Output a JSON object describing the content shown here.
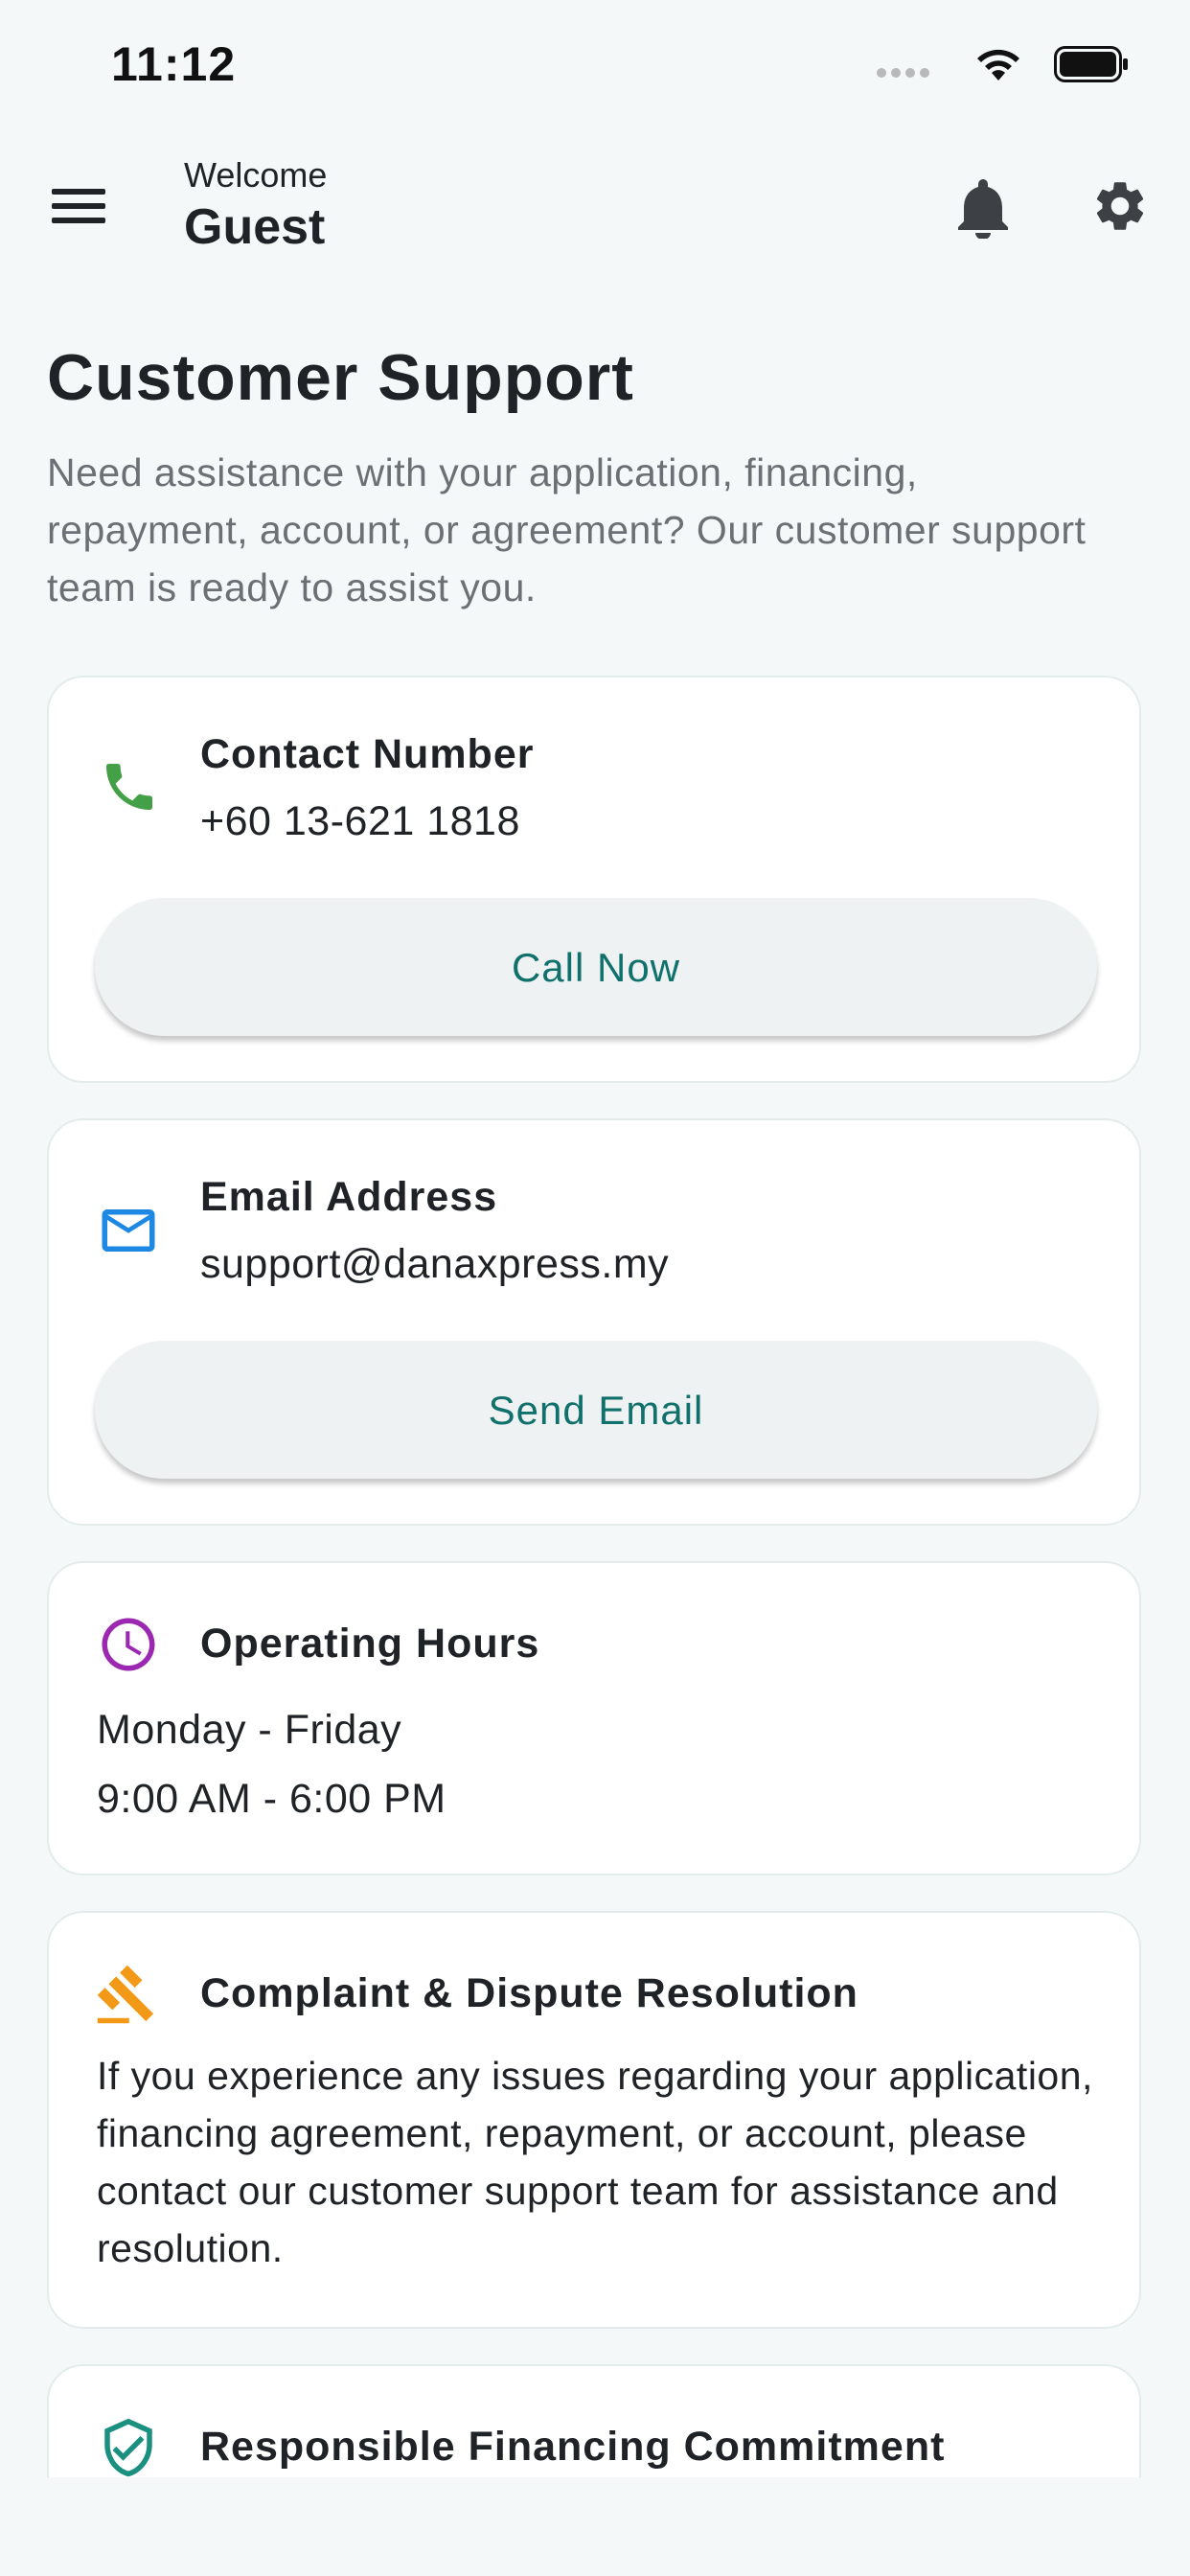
{
  "status_bar": {
    "time": "11:12",
    "icons": [
      "signal-dots-icon",
      "wifi-icon",
      "battery-icon"
    ]
  },
  "header": {
    "welcome": "Welcome",
    "user_name": "Guest",
    "icons": [
      "menu-icon",
      "bell-icon",
      "gear-icon"
    ]
  },
  "page": {
    "title": "Customer Support",
    "description": "Need assistance with your application, financing, repayment, account, or agreement? Our customer support team is ready to assist you."
  },
  "contact": {
    "icon": "phone-icon",
    "title": "Contact Number",
    "value": "+60 13-621 1818",
    "button": "Call Now"
  },
  "email": {
    "icon": "mail-icon",
    "title": "Email Address",
    "value": "support@danaxpress.my",
    "button": "Send Email"
  },
  "hours": {
    "icon": "clock-icon",
    "title": "Operating Hours",
    "days": "Monday - Friday",
    "time": "9:00 AM - 6:00 PM"
  },
  "complaint": {
    "icon": "gavel-icon",
    "title": "Complaint & Dispute Resolution",
    "text": "If you experience any issues regarding your application, financing agreement, repayment, or account, please contact our customer support team for assistance and resolution."
  },
  "responsible": {
    "icon": "shield-check-icon",
    "title": "Responsible Financing Commitment"
  },
  "colors": {
    "background": "#f4f8f8",
    "accent": "#10706b",
    "phone": "#43a047",
    "mail": "#1e88e5",
    "clock": "#9c27b0",
    "gavel": "#f29a17",
    "shield": "#1b9080"
  }
}
